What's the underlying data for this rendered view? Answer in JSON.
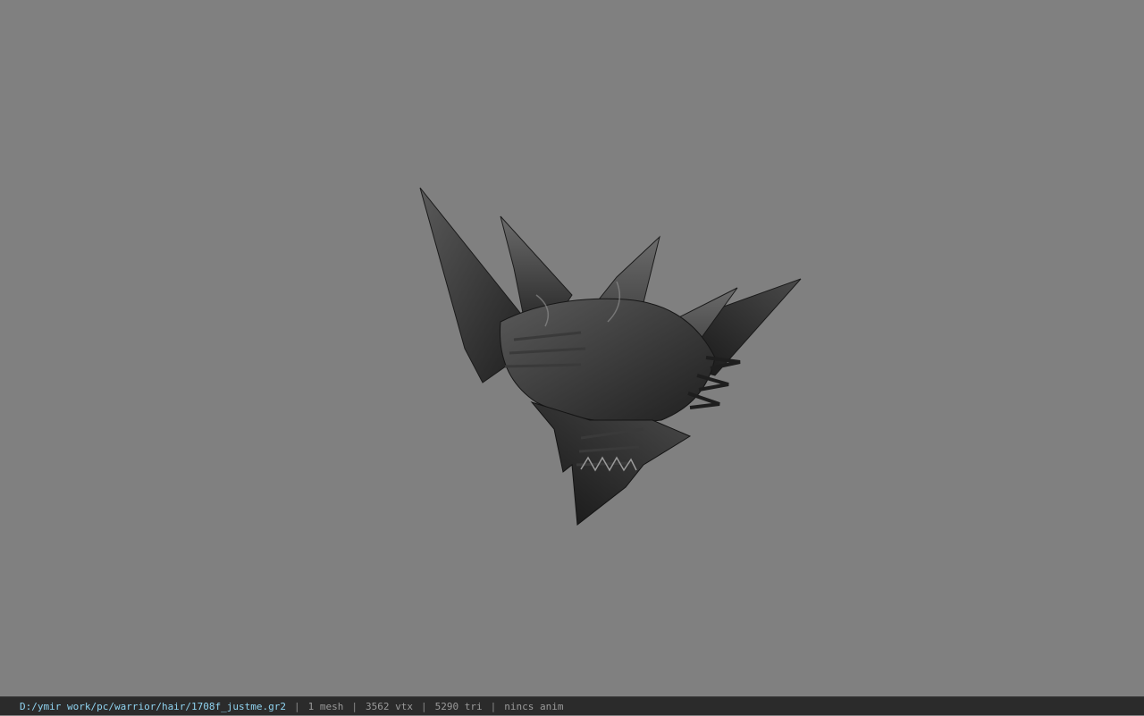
{
  "viewport": {
    "background_color": "#808080",
    "model": {
      "name": "dragon-helmet",
      "tone": "dark-grey"
    }
  },
  "statusbar": {
    "file_path": "D:/ymir work/pc/warrior/hair/1708f_justme.gr2",
    "separator": "|",
    "mesh_count": "1 mesh",
    "vertex_count": "3562 vtx",
    "triangle_count": "5290 tri",
    "anim_status": "nincs anim",
    "path_color": "#8fd3f0",
    "bar_color": "#2b2b2b"
  }
}
